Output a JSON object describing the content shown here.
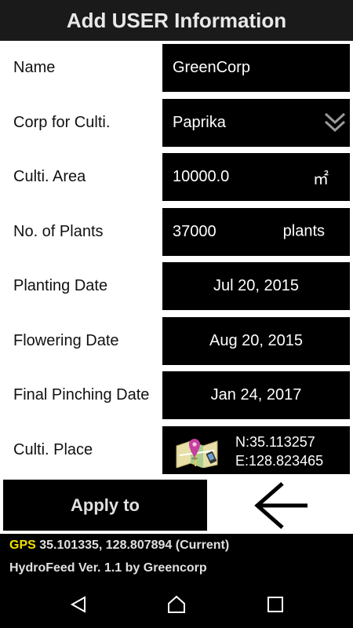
{
  "header": {
    "title": "Add USER Information"
  },
  "form": {
    "name": {
      "label": "Name",
      "value": "GreenCorp"
    },
    "crop": {
      "label": "Corp for Culti.",
      "value": "Paprika",
      "icon": "chevron-double-down-icon"
    },
    "area": {
      "label": "Culti. Area",
      "value": "10000.0",
      "unit": "㎡"
    },
    "plants": {
      "label": "No. of Plants",
      "value": "37000",
      "unit": "plants"
    },
    "planting_date": {
      "label": "Planting Date",
      "value": "Jul 20, 2015"
    },
    "flowering_date": {
      "label": "Flowering Date",
      "value": "Aug 20, 2015"
    },
    "final_pinching_date": {
      "label": "Final Pinching Date",
      "value": "Jan 24, 2017"
    },
    "place": {
      "label": "Culti. Place",
      "lat": "N:35.113257",
      "lon": "E:128.823465",
      "icon": "map-pin-icon"
    }
  },
  "actions": {
    "apply_label": "Apply to",
    "back_icon": "back-arrow-icon"
  },
  "status": {
    "gps_tag": "GPS",
    "gps_value": "35.101335, 128.807894 (Current)",
    "version": "HydroFeed Ver. 1.1 by Greencorp",
    "gps_tag_color": "#f0e000"
  },
  "navbar": {
    "back": "nav-back-icon",
    "home": "nav-home-icon",
    "recents": "nav-recents-icon"
  }
}
